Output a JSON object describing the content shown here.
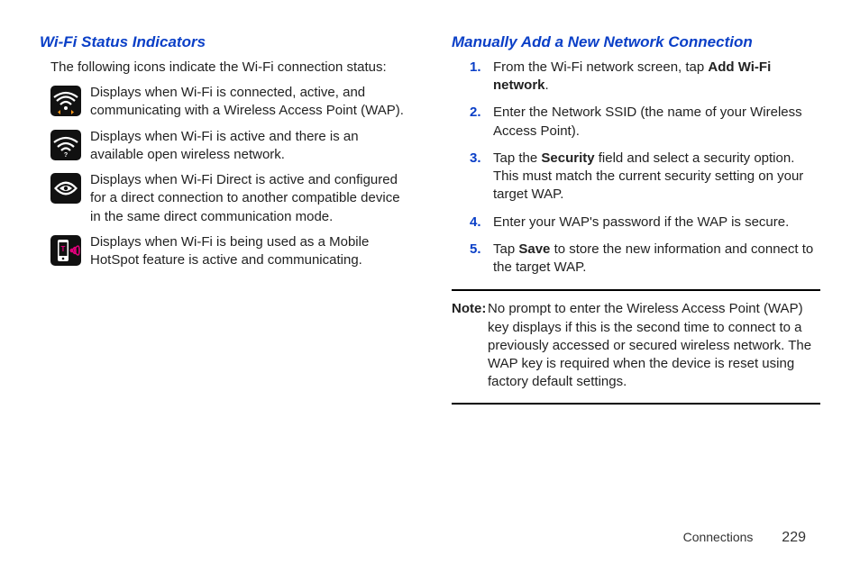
{
  "left": {
    "heading": "Wi-Fi Status Indicators",
    "intro": "The following icons indicate the Wi-Fi connection status:",
    "icons": [
      " Displays when Wi-Fi is connected, active, and communicating with a Wireless Access Point (WAP).",
      "Displays when Wi-Fi is active and there is an available open wireless network.",
      "Displays when Wi-Fi Direct is active and configured for a direct connection to another compatible device in the same direct communication mode.",
      "Displays when Wi-Fi is being used as a Mobile HotSpot feature is active and communicating."
    ]
  },
  "right": {
    "heading": "Manually Add a New Network Connection",
    "steps": {
      "s1_a": "From the Wi-Fi network screen, tap ",
      "s1_b": "Add Wi-Fi network",
      "s1_c": ".",
      "s2": "Enter the Network SSID (the name of your Wireless Access Point).",
      "s3_a": "Tap the ",
      "s3_b": "Security",
      "s3_c": " field and select a security option. This must match the current security setting on your target WAP.",
      "s4": "Enter your WAP's password if the WAP is secure.",
      "s5_a": "Tap ",
      "s5_b": "Save",
      "s5_c": " to store the new information and connect to the target WAP."
    },
    "note_label": "Note:",
    "note_body": "No prompt to enter the Wireless Access Point (WAP) key displays if this is the second time to connect to a previously accessed or secured wireless network. The WAP key is required when the device is reset using factory default settings."
  },
  "footer": {
    "section": "Connections",
    "page": "229"
  }
}
